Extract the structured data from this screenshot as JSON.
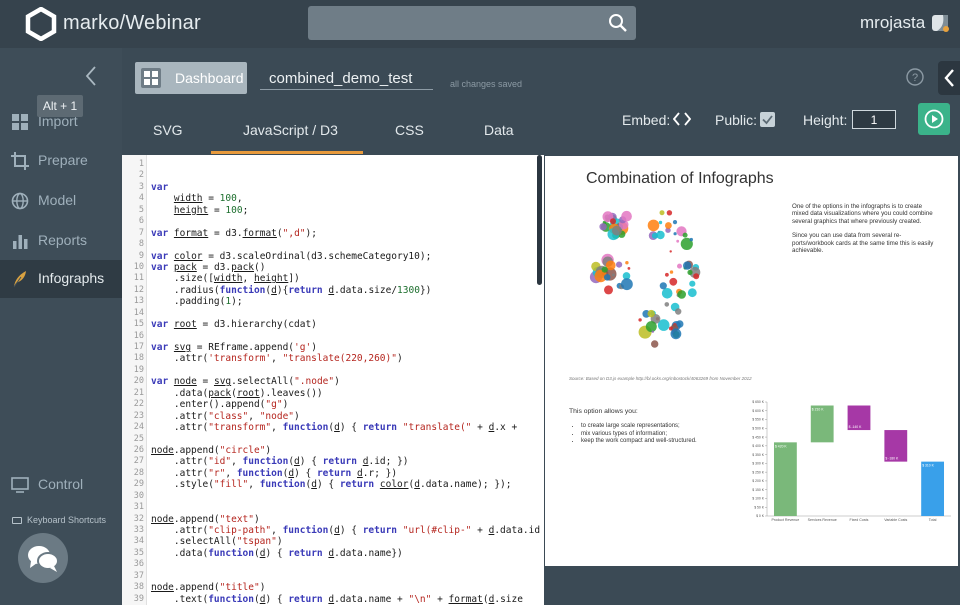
{
  "app": {
    "title": "marko/Webinar",
    "username": "mrojasta"
  },
  "search": {
    "placeholder": ""
  },
  "sidebar": {
    "items": [
      {
        "label": "Import",
        "icon": "import-icon"
      },
      {
        "label": "Prepare",
        "icon": "crop-icon"
      },
      {
        "label": "Model",
        "icon": "globe-icon"
      },
      {
        "label": "Reports",
        "icon": "bar-chart-icon"
      },
      {
        "label": "Infographs",
        "icon": "feather-icon"
      }
    ],
    "active": "Infographs",
    "tooltip": "Alt + 1",
    "control_label": "Control",
    "shortcuts_label": "Keyboard Shortcuts"
  },
  "header": {
    "dashboard_label": "Dashboard",
    "doc_title": "combined_demo_test",
    "save_status": "all changes saved"
  },
  "tabs": [
    {
      "label": "SVG"
    },
    {
      "label": "JavaScript / D3",
      "active": true
    },
    {
      "label": "CSS"
    },
    {
      "label": "Data"
    }
  ],
  "toolbar": {
    "embed_label": "Embed:",
    "public_label": "Public:",
    "public_checked": true,
    "height_label": "Height:",
    "height_value": "1"
  },
  "code": {
    "lines": [
      "",
      "",
      "var",
      "    width = 100,",
      "    height = 100;",
      "",
      "var format = d3.format(\",d\");",
      "",
      "var color = d3.scaleOrdinal(d3.schemeCategory10);",
      "var pack = d3.pack()",
      "    .size([width, height])",
      "    .radius(function(d){return d.data.size/1300})",
      "    .padding(1);",
      "",
      "var root = d3.hierarchy(cdat)",
      "",
      "var svg = REframe.append('g')",
      "    .attr('transform', \"translate(220,260)\")",
      "",
      "var node = svg.selectAll(\".node\")",
      "    .data(pack(root).leaves())",
      "    .enter().append(\"g\")",
      "    .attr(\"class\", \"node\")",
      "    .attr(\"transform\", function(d) { return \"translate(\" + d.x +",
      "",
      "node.append(\"circle\")",
      "    .attr(\"id\", function(d) { return d.id; })",
      "    .attr(\"r\", function(d) { return d.r; })",
      "    .style(\"fill\", function(d) { return color(d.data.name); });",
      "",
      "",
      "node.append(\"text\")",
      "    .attr(\"clip-path\", function(d) { return \"url(#clip-\" + d.data.id +",
      "    .selectAll(\"tspan\")",
      "    .data(function(d) { return d.data.name})",
      "",
      "",
      "node.append(\"title\")",
      "    .text(function(d) { return d.data.name + \"\\n\" + format(d.size"
    ]
  },
  "preview": {
    "title": "Combination of Infographs",
    "desc1": "One of the options in the infographs is to create mixed data visualizations where you could combine several graphics that where previously created.",
    "desc2": "Since you can use data from several re- ports/workbook cards at the same time this is easily achievable.",
    "source": "Source: Based on D3.js example http://bl.ocks.org/mbostock/4063269 from November 2012",
    "list_title": "This option allows you:",
    "list": [
      "to create large scale representations;",
      "mix various types of information;",
      "keep the work compact and well-structured."
    ]
  },
  "chart_data": {
    "type": "bar",
    "subtype": "waterfall",
    "categories": [
      "Product Revenue",
      "Services Revenue",
      "Fixed Costs",
      "Variable Costs",
      "Total"
    ],
    "values": [
      420,
      210,
      -140,
      -180,
      310
    ],
    "data_labels": [
      "$ 420 K",
      "$ 210 K",
      "$ -140 K",
      "$ -180 K",
      "$ 310 K"
    ],
    "colors": [
      "#7ab87a",
      "#7ab87a",
      "#a638a6",
      "#a638a6",
      "#39a0ea"
    ],
    "y_ticks": [
      "$ 0 K",
      "$ 50 K",
      "$ 100 K",
      "$ 150 K",
      "$ 200 K",
      "$ 250 K",
      "$ 300 K",
      "$ 350 K",
      "$ 400 K",
      "$ 450 K",
      "$ 500 K",
      "$ 550 K",
      "$ 600 K",
      "$ 650 K"
    ],
    "ylim": [
      0,
      650
    ]
  },
  "colors": {
    "accent": "#e89a3c",
    "run": "#3bb38a"
  }
}
